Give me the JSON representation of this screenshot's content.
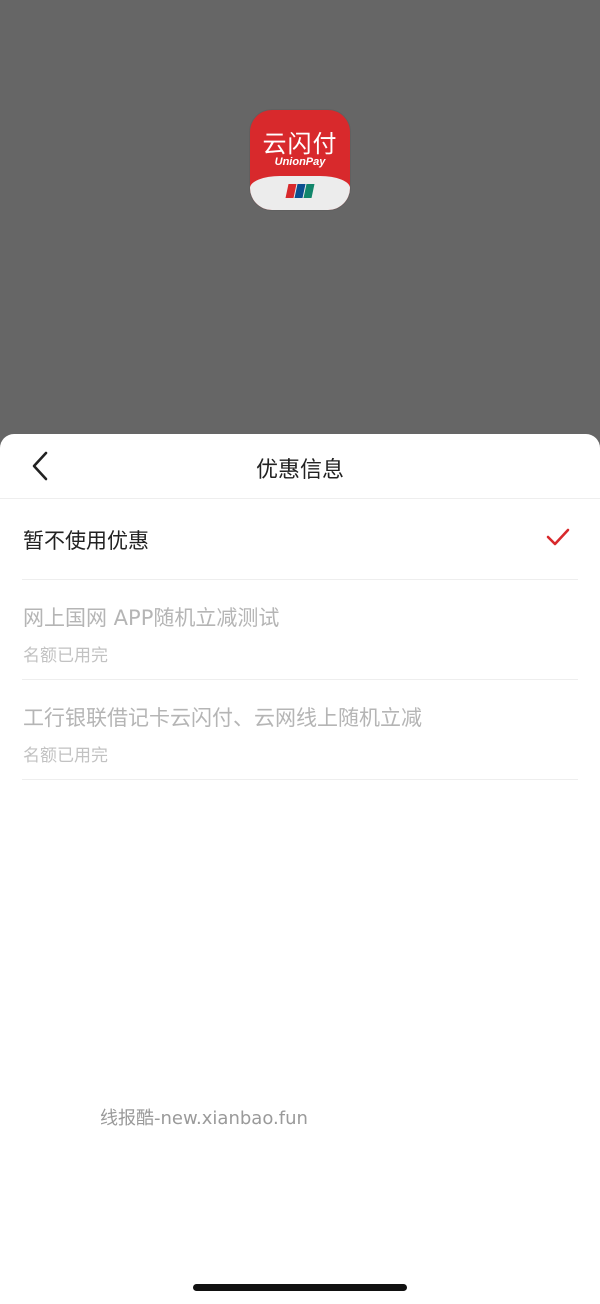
{
  "app_icon": {
    "name_cn": "云闪付",
    "name_en": "UnionPay",
    "icon": "unionpay-app-icon"
  },
  "sheet": {
    "title": "优惠信息",
    "back_icon": "chevron-left-icon"
  },
  "options": [
    {
      "label": "暂不使用优惠",
      "selected": true,
      "icon": "check-icon"
    },
    {
      "label": "网上国网 APP随机立减测试",
      "status": "名额已用完",
      "disabled": true
    },
    {
      "label": "工行银联借记卡云闪付、云网线上随机立减",
      "status": "名额已用完",
      "disabled": true
    }
  ],
  "watermark": "线报酷-new.xianbao.fun",
  "colors": {
    "overlay": "#666666",
    "accent": "#d8292c",
    "disabled_text": "#b5b5b5"
  }
}
